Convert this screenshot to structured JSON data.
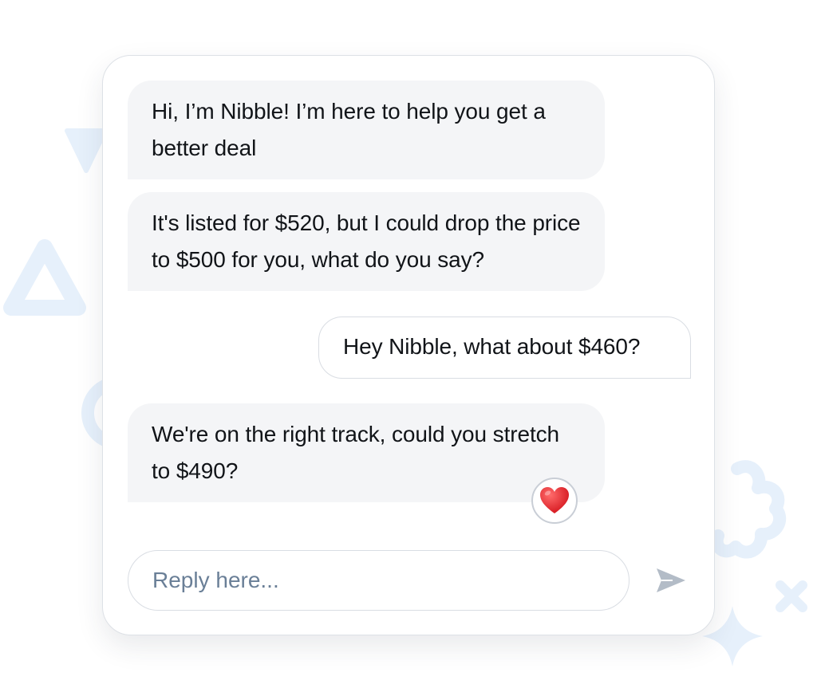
{
  "messages": [
    {
      "sender": "bot",
      "text": "Hi, I’m Nibble! I’m here to help you get a better deal"
    },
    {
      "sender": "bot",
      "text": "It's listed for $520, but I could drop the price to $500 for you, what do you say?"
    },
    {
      "sender": "user",
      "text": "Hey Nibble, what about $460?"
    },
    {
      "sender": "bot",
      "text": "We're on the right track, could you stretch to $490?",
      "reaction": "heart-icon"
    }
  ],
  "composer": {
    "placeholder": "Reply here...",
    "value": "",
    "send_icon": "send-icon"
  },
  "colors": {
    "bot_bubble": "#f4f5f7",
    "user_bubble_border": "#d9dde3",
    "placeholder_text": "#6a7f97",
    "send_icon": "#b3bcc7",
    "decor_shapes": "#e6f0fb",
    "reaction_heart": "#e8262d"
  }
}
